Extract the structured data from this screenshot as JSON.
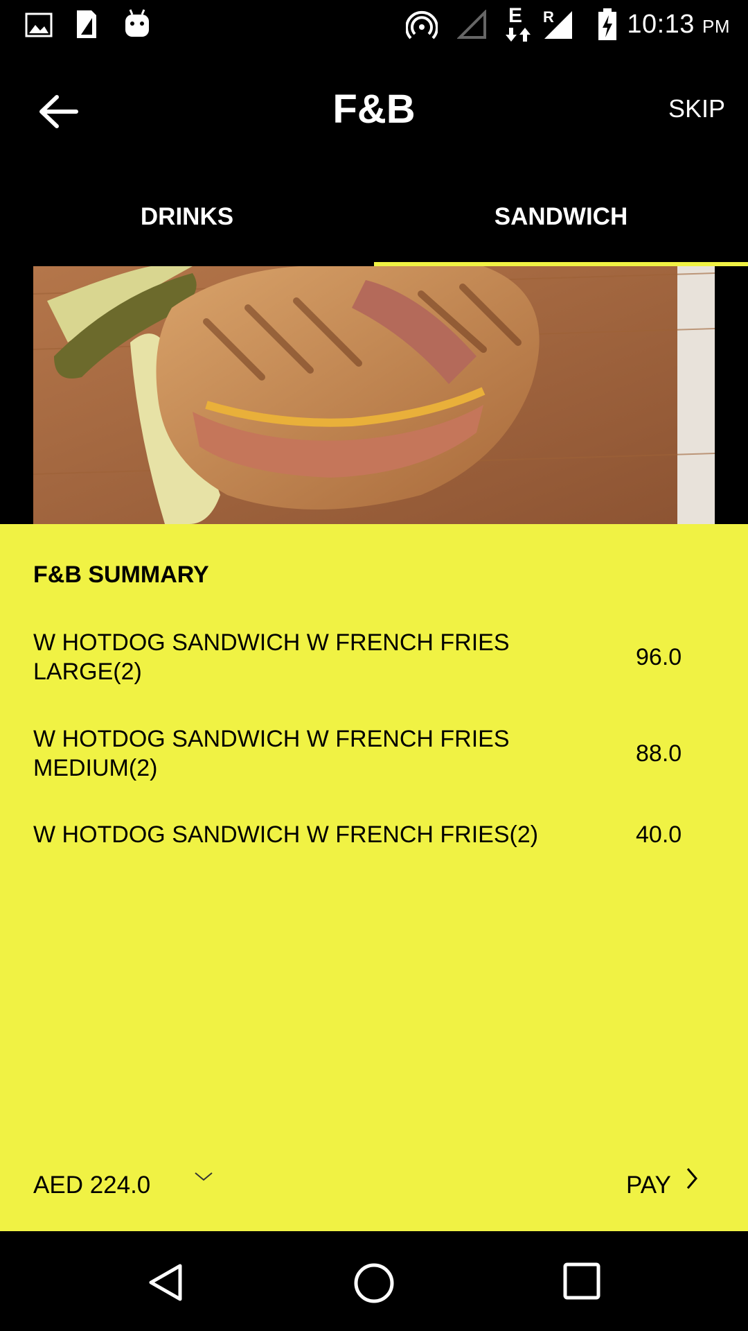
{
  "status_bar": {
    "time": "10:13",
    "period": "PM",
    "icons": [
      "image-icon",
      "sim-card-icon",
      "android-icon",
      "hotspot-icon",
      "signal-empty-icon",
      "data-e-icon",
      "signal-roaming-icon",
      "battery-charging-icon"
    ],
    "network_label": "E",
    "roaming_label": "R"
  },
  "app_bar": {
    "title": "F&B",
    "skip_label": "SKIP"
  },
  "tabs": [
    {
      "label": "DRINKS",
      "selected": false
    },
    {
      "label": "SANDWICH",
      "selected": true
    }
  ],
  "summary": {
    "title": "F&B SUMMARY",
    "items": [
      {
        "name": "W HOTDOG SANDWICH W FRENCH FRIES LARGE(2)",
        "price": "96.0"
      },
      {
        "name": "W HOTDOG SANDWICH W FRENCH FRIES MEDIUM(2)",
        "price": "88.0"
      },
      {
        "name": "W HOTDOG SANDWICH W FRENCH FRIES(2)",
        "price": "40.0"
      }
    ],
    "total": "AED 224.0",
    "pay_label": "PAY"
  },
  "colors": {
    "accent": "#f0f244",
    "background": "#000000"
  }
}
